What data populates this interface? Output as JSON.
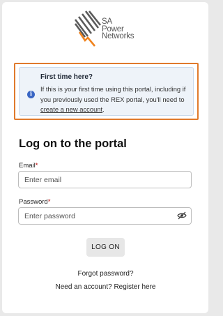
{
  "logo": {
    "line1": "SA",
    "line2": "Power",
    "line3": "Networks",
    "brand_color": "#f0831e",
    "stripe_color": "#5a5a5a",
    "icon": "sa-power-networks-logo-icon"
  },
  "notice": {
    "icon": "info-icon",
    "title": "First time here?",
    "body_text": "If this is your first time using this portal, including if you previously used the REX portal, you'll need to ",
    "link_text": "create a new account",
    "body_end": ".",
    "accent_color": "#3a66c4",
    "highlight_color": "#e07a2c"
  },
  "form": {
    "heading": "Log on to the portal",
    "email_label": "Email",
    "email_placeholder": "Enter email",
    "password_label": "Password",
    "password_placeholder": "Enter password",
    "required_marker": "*",
    "password_toggle_icon": "eye-slash-icon",
    "submit_label": "LOG ON"
  },
  "links": {
    "forgot_password": "Forgot password?",
    "register": "Need an account? Register here"
  }
}
